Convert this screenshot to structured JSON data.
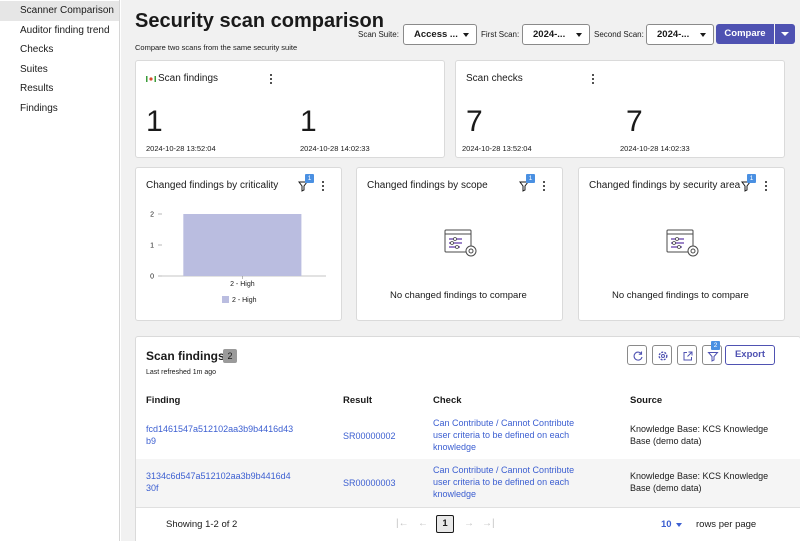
{
  "sidebar": {
    "items": [
      {
        "label": "Scanner Comparison",
        "active": true
      },
      {
        "label": "Auditor finding trend"
      },
      {
        "label": "Checks"
      },
      {
        "label": "Suites"
      },
      {
        "label": "Results"
      },
      {
        "label": "Findings"
      }
    ]
  },
  "header": {
    "title": "Security scan comparison",
    "subtitle": "Compare two scans from the same security suite",
    "scan_suite_label": "Scan Suite:",
    "scan_suite_value": "Access ...",
    "first_scan_label": "First Scan:",
    "first_scan_value": "2024-...",
    "second_scan_label": "Second Scan:",
    "second_scan_value": "2024-...",
    "compare_label": "Compare"
  },
  "scan_findings_card": {
    "title": "Scan findings",
    "first_value": "1",
    "first_date": "2024-10-28 13:52:04",
    "second_value": "1",
    "second_date": "2024-10-28 14:02:33"
  },
  "scan_checks_card": {
    "title": "Scan checks",
    "first_value": "7",
    "first_date": "2024-10-28 13:52:04",
    "second_value": "7",
    "second_date": "2024-10-28 14:02:33"
  },
  "criticality_card": {
    "title": "Changed findings by criticality",
    "filter_count": "1"
  },
  "scope_card": {
    "title": "Changed findings by scope",
    "filter_count": "1",
    "empty_message": "No changed findings to compare"
  },
  "area_card": {
    "title": "Changed findings by security area",
    "filter_count": "1",
    "empty_message": "No changed findings to compare"
  },
  "chart_data": {
    "type": "bar",
    "categories": [
      "2 - High"
    ],
    "series": [
      {
        "name": "2 - High",
        "values": [
          2
        ]
      }
    ],
    "yticks": [
      "0",
      "1",
      "2"
    ],
    "ylim": [
      0,
      2
    ],
    "legend": "bottom",
    "color": "#babde0"
  },
  "findings_table": {
    "title": "Scan findings",
    "count": "2",
    "refreshed": "Last refreshed 1m ago",
    "export_label": "Export",
    "filter_count": "2",
    "columns": [
      "Finding",
      "Result",
      "Check",
      "Source"
    ],
    "rows": [
      {
        "finding": [
          "fcd1461547a512102aa3b9b4416d43",
          "b9"
        ],
        "result": "SR00000002",
        "check": [
          "Can Contribute / Cannot Contribute",
          "user criteria to be defined on each",
          "knowledge"
        ],
        "source": [
          "Knowledge Base: KCS Knowledge",
          "Base (demo data)"
        ]
      },
      {
        "finding": [
          "3134c6d547a512102aa3b9b4416d4",
          "30f"
        ],
        "result": "SR00000003",
        "check": [
          "Can Contribute / Cannot Contribute",
          "user criteria to be defined on each",
          "knowledge"
        ],
        "source": [
          "Knowledge Base: KCS Knowledge",
          "Base (demo data)"
        ]
      }
    ],
    "pagination": {
      "showing": "Showing 1-2 of 2",
      "current_page": "1",
      "rows_per_page_value": "10",
      "rows_per_page_label": "rows per page"
    }
  }
}
